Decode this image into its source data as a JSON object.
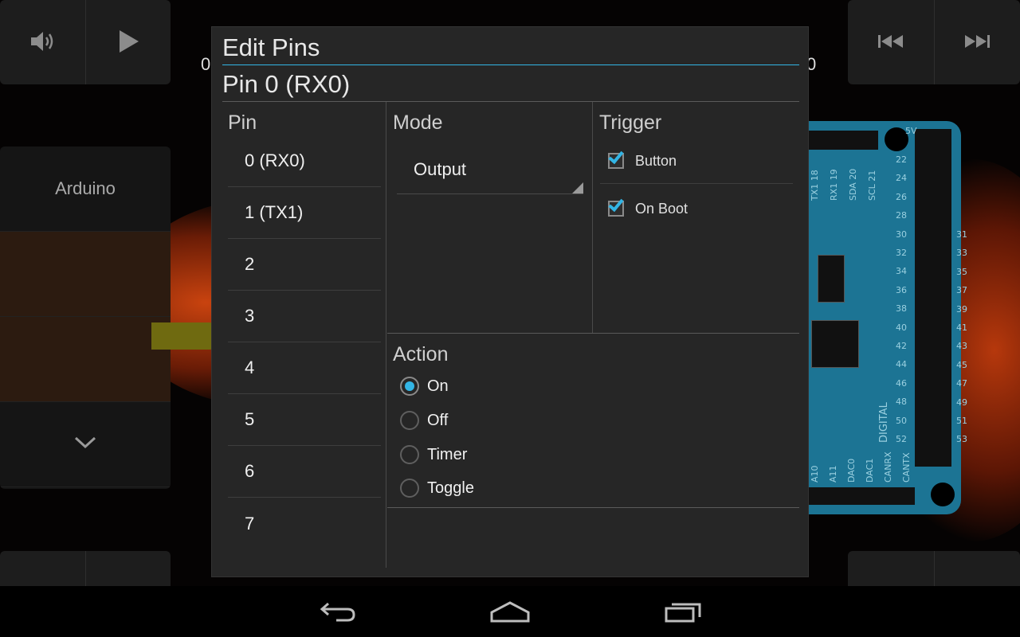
{
  "background": {
    "sidebar": {
      "title": "Arduino"
    },
    "media_controls": [
      "volume-icon",
      "play-icon",
      "skip-previous-icon",
      "skip-next-icon"
    ],
    "board": {
      "left_pin_numbers": [
        "22",
        "24",
        "26",
        "28",
        "30",
        "32",
        "34",
        "36",
        "38",
        "40",
        "42",
        "44",
        "46",
        "48",
        "50",
        "52"
      ],
      "right_pin_numbers": [
        "31",
        "33",
        "35",
        "37",
        "39",
        "41",
        "43",
        "45",
        "47",
        "49",
        "51",
        "53"
      ],
      "top_labels": [
        "TX1 18",
        "RX1 19",
        "SDA 20",
        "SCL 21"
      ],
      "bottom_labels": [
        "A10",
        "A11",
        "DAC0",
        "DAC1",
        "CANRX",
        "CANTX"
      ],
      "power_label": "5V",
      "digital_label": "DIGITAL"
    }
  },
  "dialog": {
    "title": "Edit Pins",
    "subtitle": "Pin 0 (RX0)",
    "pin_section": {
      "heading": "Pin",
      "items": [
        "0 (RX0)",
        "1 (TX1)",
        "2",
        "3",
        "4",
        "5",
        "6",
        "7"
      ]
    },
    "mode_section": {
      "heading": "Mode",
      "selected": "Output"
    },
    "trigger_section": {
      "heading": "Trigger",
      "options": [
        {
          "label": "Button",
          "checked": true
        },
        {
          "label": "On Boot",
          "checked": true
        }
      ]
    },
    "action_section": {
      "heading": "Action",
      "options": [
        {
          "label": "On",
          "selected": true
        },
        {
          "label": "Off",
          "selected": false
        },
        {
          "label": "Timer",
          "selected": false
        },
        {
          "label": "Toggle",
          "selected": false
        }
      ]
    }
  },
  "colors": {
    "accent": "#33b5e5",
    "dialog_bg": "#262626",
    "board": "#1c7494"
  },
  "navigation": {
    "buttons": [
      "back-icon",
      "home-icon",
      "recent-apps-icon"
    ]
  }
}
